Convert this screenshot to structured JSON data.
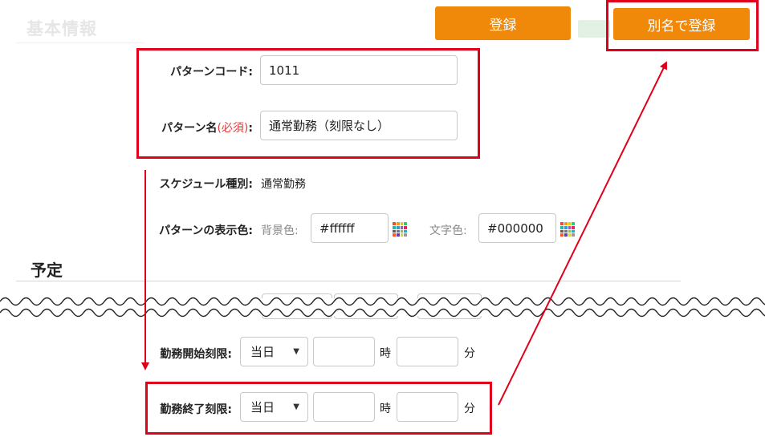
{
  "header": {
    "faded_title": "基本情報",
    "register_label": "登録",
    "register_alias_label": "別名で登録"
  },
  "form": {
    "pattern_code": {
      "label": "パターンコード:",
      "value": "1011"
    },
    "pattern_name": {
      "label_main": "パターン名",
      "label_required": "(必須)",
      "label_colon": ":",
      "value": "通常勤務（刻限なし）"
    },
    "schedule_type": {
      "label": "スケジュール種別:",
      "value": "通常勤務"
    },
    "display_color": {
      "label": "パターンの表示色:",
      "bg_label": "背景色:",
      "bg_value": "#ffffff",
      "text_label": "文字色:",
      "text_value": "#000000"
    }
  },
  "schedule": {
    "title": "予定",
    "start_limit": {
      "label": "勤務開始刻限:",
      "day": "当日",
      "hour_unit": "時",
      "minute_unit": "分",
      "hour": "",
      "minute": ""
    },
    "end_limit": {
      "label": "勤務終了刻限:",
      "day": "当日",
      "hour_unit": "時",
      "minute_unit": "分",
      "hour": "",
      "minute": ""
    }
  },
  "colors": {
    "accent": "#f0880a",
    "annotation_red": "#e0001b",
    "required_red": "#e23b3b"
  },
  "icons": [
    "color-palette-icon",
    "dropdown-caret-icon"
  ]
}
